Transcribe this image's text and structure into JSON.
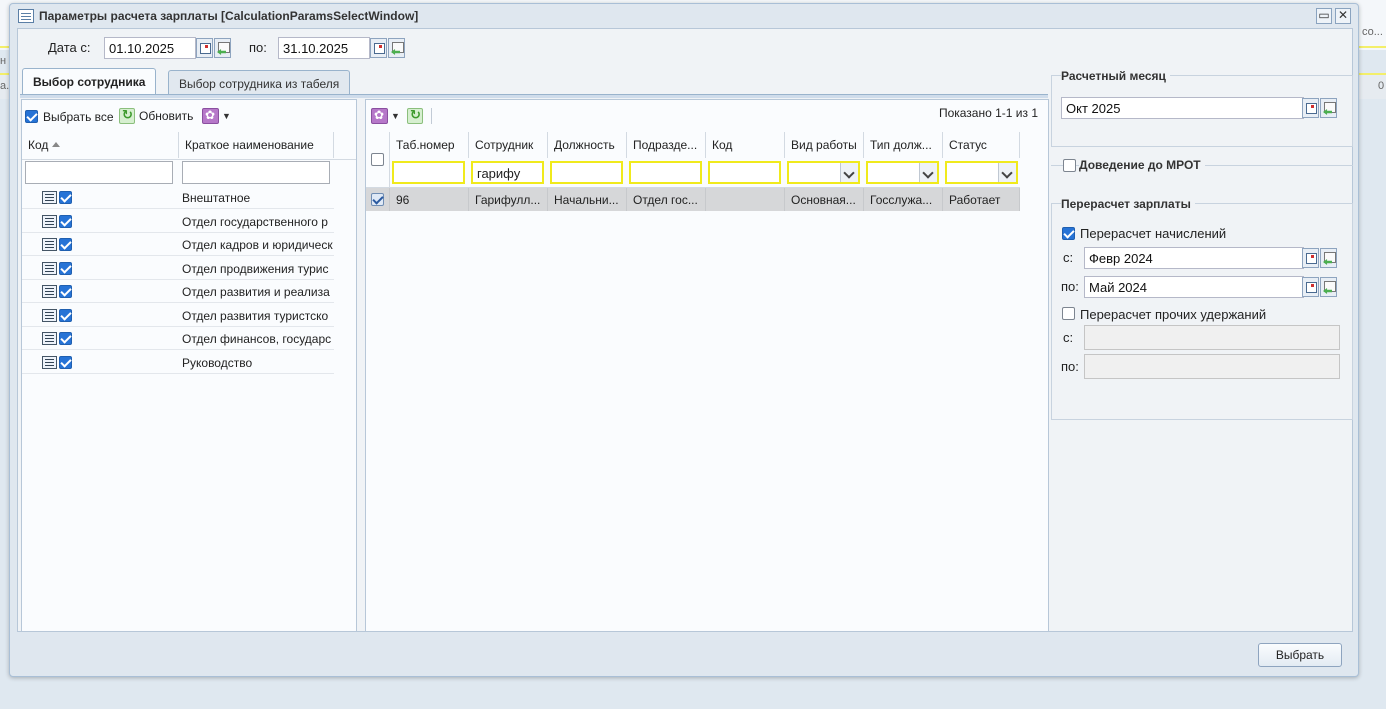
{
  "background": {
    "right_text": "со...",
    "left_text_1": "н",
    "left_text_2": "а.",
    "right_text_2": "0"
  },
  "window": {
    "title": "Параметры расчета зарплаты [CalculationParamsSelectWindow]"
  },
  "date_range": {
    "from_label": "Дата с:",
    "from_value": "01.10.2025",
    "to_label": "по:",
    "to_value": "31.10.2025"
  },
  "tabs": [
    {
      "label": "Выбор сотрудника",
      "active": true
    },
    {
      "label": "Выбор сотрудника из табеля",
      "active": false
    }
  ],
  "left_panel": {
    "select_all_label": "Выбрать все",
    "refresh_label": "Обновить",
    "columns": {
      "code": "Код",
      "name": "Краткое наименование"
    },
    "filters": {
      "code": "",
      "name": ""
    },
    "rows": [
      {
        "name": "Внештатное"
      },
      {
        "name": "Отдел государственного р"
      },
      {
        "name": "Отдел кадров и юридическ"
      },
      {
        "name": "Отдел продвижения турис"
      },
      {
        "name": "Отдел развития и реализа"
      },
      {
        "name": "Отдел развития туристско"
      },
      {
        "name": "Отдел финансов, государс"
      },
      {
        "name": "Руководство"
      }
    ]
  },
  "grid": {
    "paging_text": "Показано 1-1 из 1",
    "columns": [
      "Таб.номер",
      "Сотрудник",
      "Должность",
      "Подразде...",
      "Код",
      "Вид работы",
      "Тип долж...",
      "Статус"
    ],
    "filters": [
      "",
      "гарифу",
      "",
      "",
      "",
      "",
      "",
      ""
    ],
    "rows": [
      {
        "cells": [
          "96",
          "Гарифулл...",
          "Начальни...",
          "Отдел гос...",
          "",
          "Основная...",
          "Госслужа...",
          "Работает"
        ]
      }
    ]
  },
  "right_panel": {
    "month_title": "Расчетный месяц",
    "month_value": "Окт 2025",
    "mrot_label": "Доведение до МРОТ",
    "recalc_title": "Перерасчет зарплаты",
    "recalc_accruals_label": "Перерасчет начислений",
    "from_label": "с:",
    "from_value": "Февр 2024",
    "to_label": "по:",
    "to_value": "Май 2024",
    "recalc_other_label": "Перерасчет прочих удержаний",
    "other_from_label": "с:",
    "other_from_value": "",
    "other_to_label": "по:",
    "other_to_value": ""
  },
  "footer": {
    "select_button": "Выбрать"
  }
}
